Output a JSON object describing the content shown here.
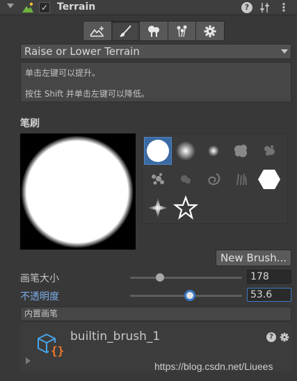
{
  "header": {
    "title": "Terrain",
    "enabled_check": "✓",
    "help_glyph": "?",
    "more_glyph": "⋮"
  },
  "toolbar": {
    "tools": [
      {
        "name": "create-neighbor-terrains-tool"
      },
      {
        "name": "paint-terrain-tool",
        "active": true
      },
      {
        "name": "paint-trees-tool"
      },
      {
        "name": "paint-details-tool"
      },
      {
        "name": "terrain-settings-tool"
      }
    ]
  },
  "dropdown": {
    "value": "Raise or Lower Terrain"
  },
  "helpbox": {
    "line1": "单击左键可以提升。",
    "line2": "按住 Shift 并单击左键可以降低。"
  },
  "brushes": {
    "section_title": "笔刷",
    "new_brush_label": "New Brush...",
    "selected_index": 0,
    "items": [
      "hard-circle",
      "soft-circle",
      "small-soft-dot",
      "cloud-noise",
      "splatter-noise",
      "scatter-blob",
      "faint-noise",
      "swirl",
      "grass-strokes",
      "hexagon",
      "spark-star",
      "outline-star"
    ]
  },
  "brush_size": {
    "label": "画笔大小",
    "value": "178",
    "fraction": 0.27
  },
  "opacity": {
    "label": "不透明度",
    "value": "53.6",
    "fraction": 0.536
  },
  "builtin": {
    "header": "内置画笔",
    "brush_name": "builtin_brush_1",
    "help_glyph": "?"
  },
  "watermark": "https://blog.csdn.net/Liuees",
  "colors": {
    "accent": "#3a79c8",
    "highlight_text": "#7aabe8",
    "selected_cell": "#3b6aa3",
    "brush_icon_blue": "#4aa3e8",
    "brush_icon_orange": "#f07a2a"
  }
}
